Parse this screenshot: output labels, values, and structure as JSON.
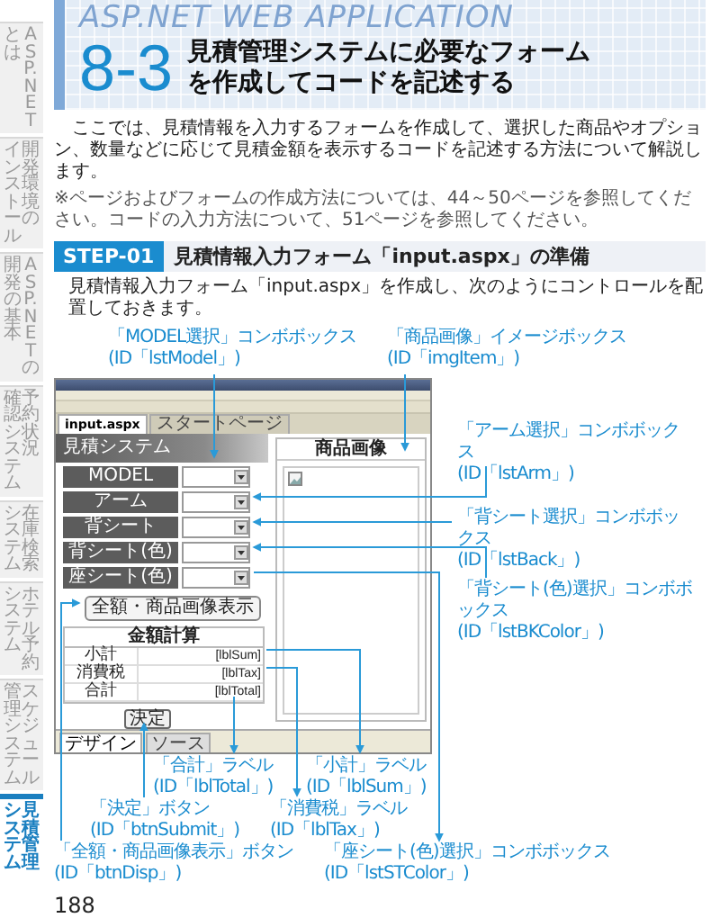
{
  "sidebar": {
    "tabs": [
      {
        "lines": [
          "とは",
          "ASP.NET"
        ],
        "selected": false
      },
      {
        "lines": [
          "インストール",
          "開発環境の"
        ],
        "selected": false
      },
      {
        "lines": [
          "開発の基本",
          "ASP.NETの"
        ],
        "selected": false
      },
      {
        "lines": [
          "確認システム",
          "予約状況"
        ],
        "selected": false
      },
      {
        "lines": [
          "システム",
          "在庫検索"
        ],
        "selected": false
      },
      {
        "lines": [
          "システム",
          "ホテル予約"
        ],
        "selected": false
      },
      {
        "lines": [
          "管理システム",
          "スケジュール"
        ],
        "selected": false
      },
      {
        "lines": [
          "システム",
          "見積管理"
        ],
        "selected": true
      }
    ]
  },
  "header": {
    "watermark": "ASP.NET WEB APPLICATION",
    "number": "8-3",
    "title_lines": [
      "見積管理システムに必要なフォーム",
      "を作成してコードを記述する"
    ]
  },
  "intro": "ここでは、見積情報を入力するフォームを作成して、選択した商品やオプション、数量などに応じて見積金額を表示するコードを記述する方法について解説します。",
  "note": "※ページおよびフォームの作成方法については、44～50ページを参照してください。コードの入力方法について、51ページを参照してください。",
  "step": {
    "badge": "STEP-01",
    "title": "見積情報入力フォーム「input.aspx」の準備",
    "text": "見積情報入力フォーム「input.aspx」を作成し、次のようにコントロールを配置しておきます。"
  },
  "figure": {
    "screenshot": {
      "tabs": [
        {
          "label": "input.aspx",
          "selected": true
        },
        {
          "label": "スタートページ",
          "selected": false
        }
      ],
      "banner": "見積システム",
      "form_rows": [
        {
          "label": "MODEL"
        },
        {
          "label": "アーム"
        },
        {
          "label": "背シート"
        },
        {
          "label": "背シート(色)"
        },
        {
          "label": "座シート(色)"
        }
      ],
      "display_button": "全額・商品画像表示",
      "image_heading": "商品画像",
      "calc_heading": "金額計算",
      "calc_rows": [
        {
          "label": "小計",
          "value": "[lblSum]"
        },
        {
          "label": "消費税",
          "value": "[lblTax]"
        },
        {
          "label": "合計",
          "value": "[lblTotal]"
        }
      ],
      "submit_button": "決定",
      "view_tabs": [
        {
          "label": "デザイン",
          "selected": true
        },
        {
          "label": "ソース",
          "selected": false
        }
      ]
    },
    "callouts": [
      {
        "text": "「MODEL選択」コンボボックス",
        "id": "(ID「lstModel」)"
      },
      {
        "text": "「商品画像」イメージボックス",
        "id": "(ID「imgItem」)"
      },
      {
        "text": "「アーム選択」コンボボックス",
        "id": "(ID「lstArm」)"
      },
      {
        "text": "「背シート選択」コンボボックス",
        "id": "(ID「lstBack」)"
      },
      {
        "text": "「背シート(色)選択」コンボボックス",
        "id": "(ID「lstBKColor」)"
      },
      {
        "text": "「合計」ラベル",
        "id": "(ID「lblTotal」)"
      },
      {
        "text": "「小計」ラベル",
        "id": "(ID「lblSum」)"
      },
      {
        "text": "「決定」ボタン",
        "id": "(ID「btnSubmit」)"
      },
      {
        "text": "「消費税」ラベル",
        "id": "(ID「lblTax」)"
      },
      {
        "text": "「全額・商品画像表示」ボタン",
        "id": "(ID「btnDisp」)"
      },
      {
        "text": "「座シート(色)選択」コンボボックス",
        "id": "(ID「lstSTColor」)"
      }
    ]
  },
  "page_number": "188"
}
